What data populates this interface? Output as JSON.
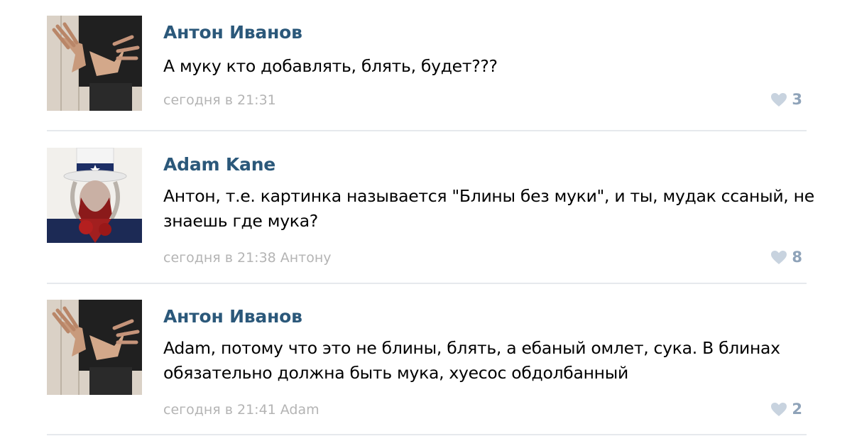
{
  "comments": [
    {
      "author": "Антон Иванов",
      "text": "А муку кто добавлять, блять, будет???",
      "time": "сегодня в 21:31",
      "reply_to": "",
      "likes": "3",
      "avatar_icon": "hands-avatar-icon"
    },
    {
      "author": "Adam Kane",
      "text": "Антон, т.е. картинка называется \"Блины без муки\", и ты, мудак ссаный, не знаешь где мука?",
      "time": "сегодня в 21:38",
      "reply_to": "Антону",
      "likes": "8",
      "avatar_icon": "uncle-sam-avatar-icon"
    },
    {
      "author": "Антон Иванов",
      "text": "Adam, потому что это не блины, блять, а ебаный омлет, сука. В блинах обязательно должна быть мука, хуесос обдолбанный",
      "time": "сегодня в 21:41",
      "reply_to": "Adam",
      "likes": "2",
      "avatar_icon": "hands-avatar-icon"
    }
  ],
  "colors": {
    "author": "#2b587a",
    "meta": "#b4b4b4",
    "likes": "#8fa3b9",
    "divider": "#e6e9ed"
  }
}
